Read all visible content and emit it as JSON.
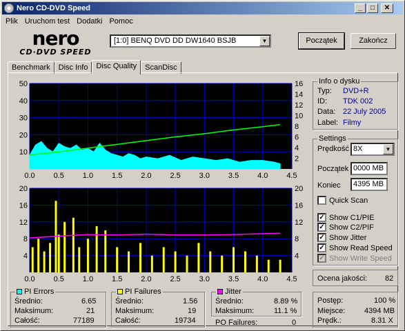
{
  "window": {
    "title": "Nero CD-DVD Speed"
  },
  "menu": [
    "Plik",
    "Uruchom test",
    "Dodatki",
    "Pomoc"
  ],
  "logo": {
    "brand": "nero",
    "subtitle": "CD·DVD SPEED"
  },
  "drive": {
    "selected": "[1:0]  BENQ DVD DD DW1640 BSJB"
  },
  "buttons": {
    "start": "Początek",
    "exit": "Zakończ"
  },
  "tabs": [
    "Benchmark",
    "Disc Info",
    "Disc Quality",
    "ScanDisc"
  ],
  "active_tab": "Disc Quality",
  "disc_info": {
    "caption": "Info o dysku",
    "rows": [
      {
        "label": "Typ:",
        "value": "DVD+R"
      },
      {
        "label": "ID:",
        "value": "TDK 002"
      },
      {
        "label": "Data:",
        "value": "22 July 2005"
      },
      {
        "label": "Label:",
        "value": "Filmy"
      }
    ]
  },
  "settings": {
    "caption": "Settings",
    "speed_label": "Prędkość",
    "speed_value": "8X",
    "start_label": "Początek",
    "start_value": "0000 MB",
    "end_label": "Koniec",
    "end_value": "4395 MB",
    "checks": [
      {
        "label": "Quick Scan",
        "checked": false,
        "disabled": false
      },
      {
        "label": "Show C1/PIE",
        "checked": true,
        "disabled": false
      },
      {
        "label": "Show C2/PIF",
        "checked": true,
        "disabled": false
      },
      {
        "label": "Show Jitter",
        "checked": true,
        "disabled": false
      },
      {
        "label": "Show Read Speed",
        "checked": true,
        "disabled": false
      },
      {
        "label": "Show Write Speed",
        "checked": true,
        "disabled": true
      }
    ]
  },
  "quality": {
    "label": "Ocena jakości:",
    "value": "82"
  },
  "progress": {
    "rows": [
      {
        "label": "Postęp:",
        "value": "100 %"
      },
      {
        "label": "Miejsce:",
        "value": "4394 MB"
      },
      {
        "label": "Prędk.:",
        "value": "8.31 X"
      }
    ]
  },
  "pi_errors": {
    "caption": "PI Errors",
    "color": "#00ffff",
    "rows": [
      {
        "label": "Średnio:",
        "value": "6.65"
      },
      {
        "label": "Maksimum:",
        "value": "21"
      },
      {
        "label": "Całość:",
        "value": "77189"
      }
    ]
  },
  "pi_failures": {
    "caption": "PI Failures",
    "color": "#ffff00",
    "rows": [
      {
        "label": "Średnio:",
        "value": "1.56"
      },
      {
        "label": "Maksimum:",
        "value": "19"
      },
      {
        "label": "Całość:",
        "value": "19734"
      }
    ]
  },
  "jitter": {
    "caption": "Jitter",
    "color": "#ff00ff",
    "rows": [
      {
        "label": "Średnio:",
        "value": "8.89 %"
      },
      {
        "label": "Maksimum:",
        "value": "11.1 %"
      }
    ],
    "po_label": "PO Failures:",
    "po_value": "0"
  },
  "chart_data": [
    {
      "type": "area",
      "title": "",
      "xlim": [
        0,
        4.5
      ],
      "ylim": [
        0,
        50
      ],
      "y2lim": [
        0,
        16
      ],
      "x_ticks": [
        "0.0",
        "0.5",
        "1.0",
        "1.5",
        "2.0",
        "2.5",
        "3.0",
        "3.5",
        "4.0",
        "4.5"
      ],
      "y_ticks": [
        "10",
        "20",
        "30",
        "40",
        "50"
      ],
      "y2_ticks": [
        "2",
        "4",
        "6",
        "8",
        "10",
        "12",
        "14",
        "16"
      ],
      "grid": true,
      "series": [
        {
          "color": "#00ffff",
          "x": [
            0.0,
            0.1,
            0.2,
            0.3,
            0.4,
            0.5,
            0.6,
            0.7,
            0.8,
            0.9,
            1.0,
            1.1,
            1.2,
            1.3,
            1.4,
            1.5,
            1.6,
            1.7,
            1.8,
            1.9,
            2.0,
            2.2,
            2.4,
            2.6,
            2.8,
            3.0,
            3.2,
            3.4,
            3.6,
            3.8,
            4.0,
            4.2,
            4.3
          ],
          "y": [
            8,
            14,
            16,
            12,
            10,
            15,
            13,
            12,
            14,
            11,
            12,
            10,
            15,
            11,
            9,
            8,
            7,
            9,
            8,
            6,
            7,
            6,
            8,
            5,
            7,
            6,
            5,
            6,
            4,
            5,
            5,
            4,
            3
          ]
        },
        {
          "color": "#00ff00",
          "axis": "right",
          "x": [
            0.0,
            0.5,
            1.0,
            1.5,
            2.0,
            2.5,
            3.0,
            3.5,
            4.0,
            4.3
          ],
          "y": [
            2.6,
            3.2,
            3.9,
            4.6,
            5.3,
            6.0,
            6.6,
            7.3,
            7.9,
            8.31
          ]
        }
      ]
    },
    {
      "type": "bar",
      "title": "",
      "xlim": [
        0,
        4.5
      ],
      "ylim": [
        0,
        20
      ],
      "x_ticks": [
        "0.0",
        "0.5",
        "1.0",
        "1.5",
        "2.0",
        "2.5",
        "3.0",
        "3.5",
        "4.0",
        "4.5"
      ],
      "y_ticks": [
        "4",
        "8",
        "12",
        "16",
        "20"
      ],
      "y2_ticks": [
        "4",
        "8",
        "12",
        "16",
        "20"
      ],
      "grid": true,
      "series": [
        {
          "color": "#ffff00",
          "x": [
            0.05,
            0.15,
            0.25,
            0.35,
            0.45,
            0.5,
            0.6,
            0.75,
            0.85,
            1.0,
            1.15,
            1.3,
            1.5,
            1.7,
            1.9,
            2.1,
            2.3,
            2.5,
            2.7,
            2.9,
            3.1,
            3.3,
            3.5,
            3.7,
            3.9,
            4.1,
            4.3
          ],
          "y": [
            6,
            8,
            5,
            7,
            17,
            9,
            12,
            13,
            6,
            8,
            11,
            10,
            6,
            5,
            7,
            4,
            6,
            5,
            4,
            7,
            5,
            4,
            6,
            5,
            4,
            3,
            3
          ]
        },
        {
          "color": "#ff00ff",
          "axis": "right",
          "x": [
            0.0,
            0.5,
            1.0,
            1.5,
            2.0,
            2.5,
            3.0,
            3.5,
            4.0,
            4.3
          ],
          "y": [
            8.2,
            8.6,
            9.0,
            8.9,
            9.1,
            8.9,
            8.9,
            9.0,
            9.2,
            9.3
          ]
        }
      ]
    }
  ]
}
